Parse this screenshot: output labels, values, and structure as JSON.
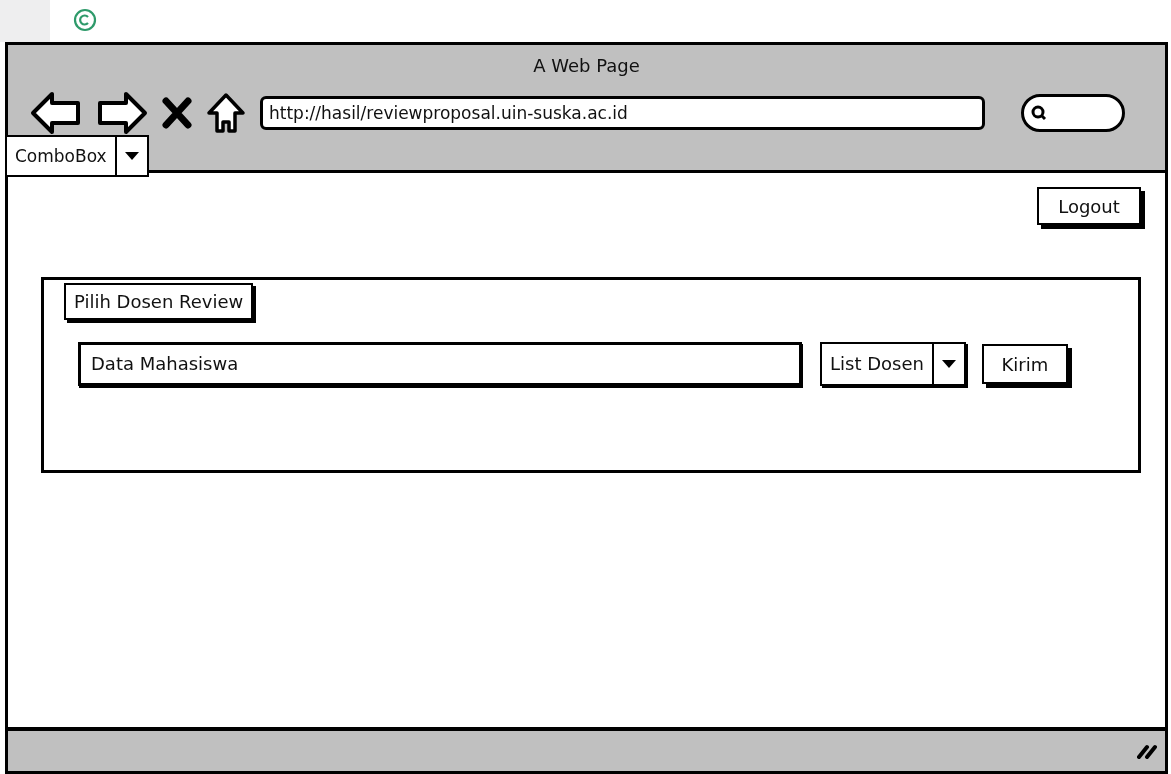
{
  "window": {
    "title": "A Web Page"
  },
  "toolbar": {
    "url": "http://hasil/reviewproposal.uin-suska.ac.id"
  },
  "combobox": {
    "value": "ComboBox"
  },
  "logout_button": "Logout",
  "panel": {
    "legend": "Pilih Dosen Review",
    "field_value": "Data Mahasiswa",
    "dropdown": "List Dosen",
    "send_button": "Kirim"
  }
}
